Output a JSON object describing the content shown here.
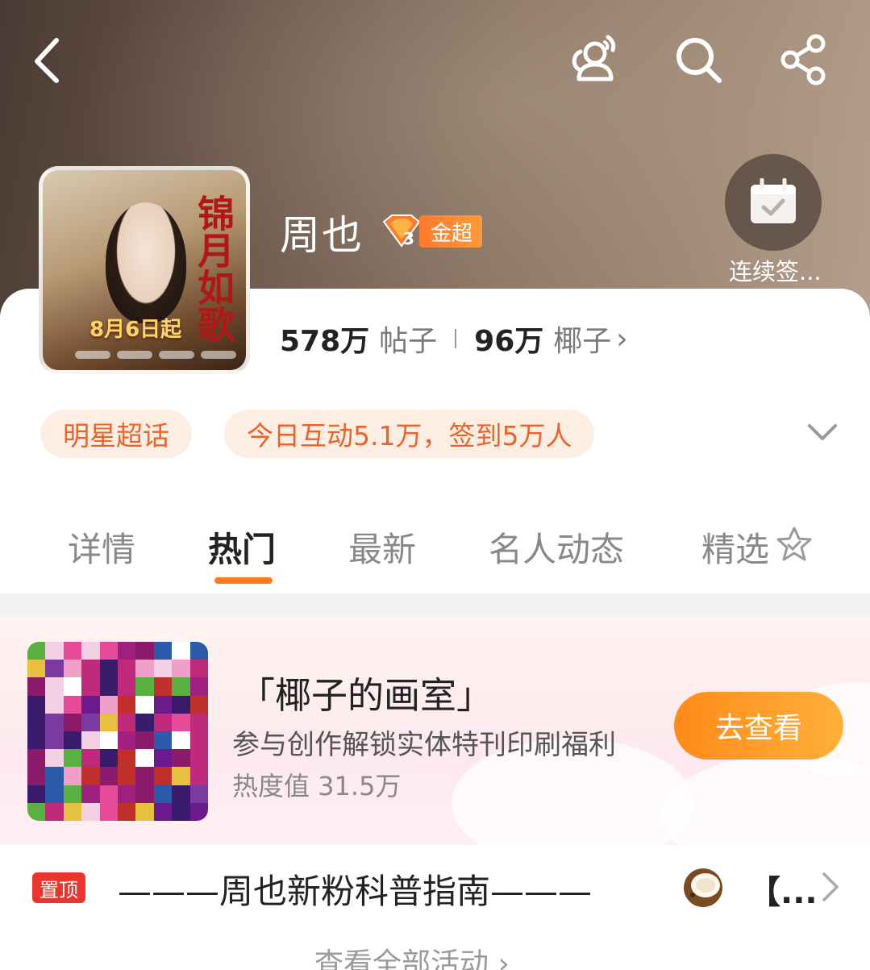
{
  "header": {
    "back_icon": "back-chevron-icon",
    "friends_icon": "friends-icon",
    "search_icon": "search-icon",
    "share_icon": "share-icon",
    "background_color": "#8a7565"
  },
  "profile": {
    "name": "周也",
    "badge_level": "3",
    "badge_label": "金超",
    "avatar_poster_title": "锦月如歌",
    "avatar_poster_date": "8月6日起",
    "checkin_label": "连续签...",
    "checkin_icon": "calendar-check-icon"
  },
  "stats": {
    "posts_count": "578万",
    "posts_label": "帖子",
    "coconuts_count": "96万",
    "coconuts_label": "椰子",
    "arrow": "›"
  },
  "tags": {
    "category": "明星超话",
    "activity": "今日互动5.1万，签到5万人",
    "expand_icon": "chevron-down-icon",
    "tag_bg": "#fdeee4",
    "tag_color": "#e8642a"
  },
  "tabs": [
    {
      "label": "详情",
      "active": false
    },
    {
      "label": "热门",
      "active": true
    },
    {
      "label": "最新",
      "active": false
    },
    {
      "label": "名人动态",
      "active": false
    },
    {
      "label": "精选",
      "active": false
    }
  ],
  "tab_indicator_color": "#ff7a1a",
  "banner": {
    "title": "「椰子的画室」",
    "subtitle": "参与创作解锁实体特刊印刷福利",
    "heat": "热度值 31.5万",
    "button": "去查看",
    "button_color": "#ff9a2a"
  },
  "pinned": {
    "badge": "置顶",
    "title": "———周也新粉科普指南———",
    "more": "【...",
    "badge_color": "#e8362e"
  },
  "footer": {
    "view_all": "查看全部活动 ›"
  }
}
